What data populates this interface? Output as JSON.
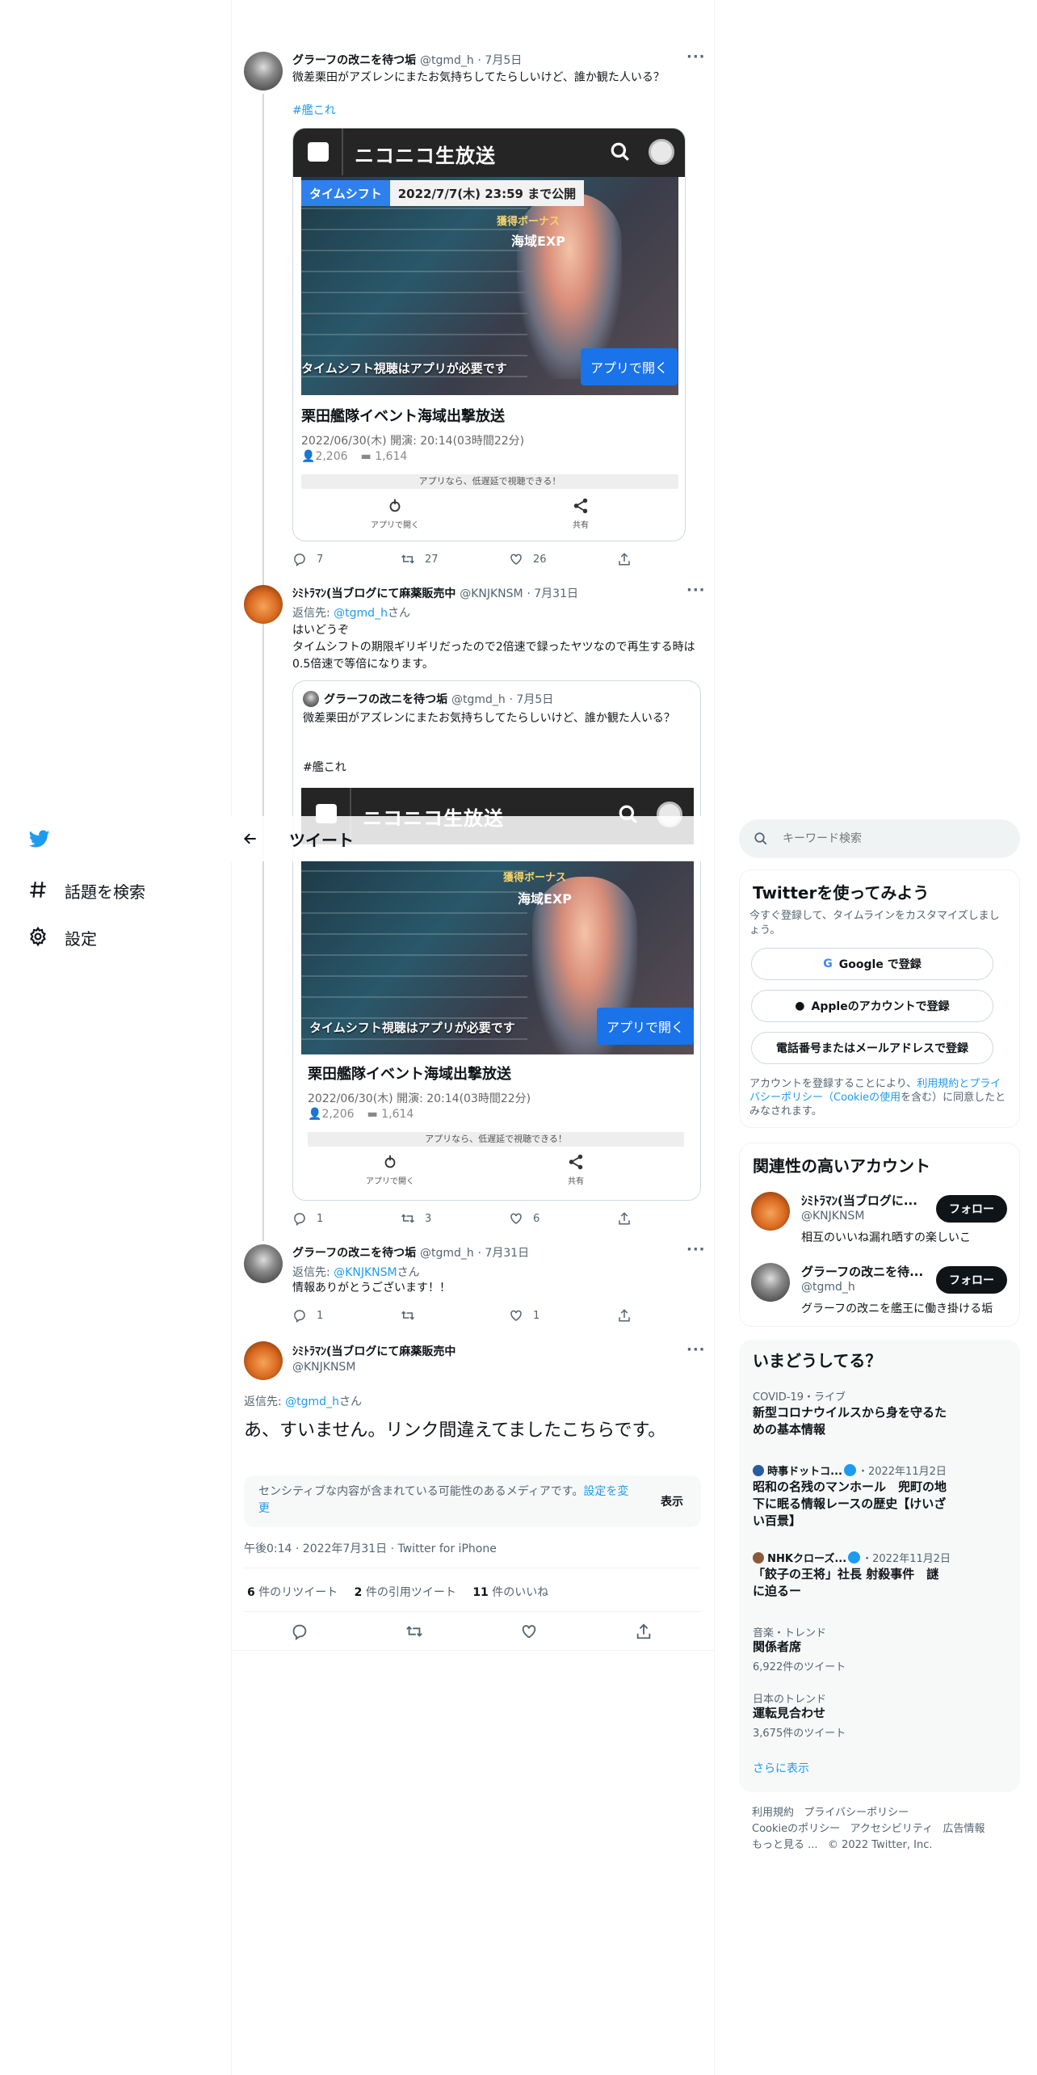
{
  "nav": {
    "explore_label": "話題を検索",
    "settings_label": "設定"
  },
  "header": {
    "title": "ツイート"
  },
  "search": {
    "placeholder": "キーワード検索"
  },
  "tweet1": {
    "name": "グラーフの改ニを待つ垢",
    "handle": "@tgmd_h",
    "date": "· 7月5日",
    "text": "微差栗田がアズレンにまたお気持ちしてたらしいけど、誰か観た人いる？",
    "hashtag": "#艦これ",
    "stats": {
      "replies": "7",
      "retweets": "27",
      "likes": "26"
    }
  },
  "card": {
    "brand": "ニコニコ生放送",
    "badge_label": "タイムシフト",
    "badge_date": "2022/7/7(木) 23:59 まで公開",
    "app_note": "タイムシフト視聴はアプリが必要です",
    "open_label": "アプリで開く",
    "title": "栗田艦隊イベント海域出撃放送",
    "meta": "2022/06/30(木) 開演: 20:14(03時間22分)",
    "viewers": "2,206",
    "comments": "1,614",
    "low_delay": "アプリなら、低遅延で視聴できる！",
    "act_open": "アプリで開く",
    "act_share": "共有",
    "bonus": "獲得ボーナス",
    "bonus2": "海域EXP"
  },
  "tweet2": {
    "name": "ｼﾐﾄﾗﾏﾝ(当ブログにて麻薬販売中",
    "handle": "@KNJKNSM",
    "date": "· 7月31日",
    "reply_prefix": "返信先: ",
    "reply_to": "@tgmd_h",
    "reply_suffix": "さん",
    "line1": "はいどうぞ",
    "line2": "タイムシフトの期限ギリギリだったので2倍速で録ったヤツなので再生する時は0.5倍速で等倍になります。",
    "stats": {
      "replies": "1",
      "retweets": "3",
      "likes": "6"
    }
  },
  "quote": {
    "name": "グラーフの改ニを待つ垢",
    "handle": "@tgmd_h",
    "date": "· 7月5日",
    "text": "微差栗田がアズレンにまたお気持ちしてたらしいけど、誰か観た人いる？",
    "hashtag": "#艦これ"
  },
  "tweet3": {
    "name": "グラーフの改ニを待つ垢",
    "handle": "@tgmd_h",
    "date": "· 7月31日",
    "reply_prefix": "返信先: ",
    "reply_to": "@KNJKNSM",
    "reply_suffix": "さん",
    "text": "情報ありがとうございます！！",
    "stats": {
      "replies": "1",
      "retweets": "",
      "likes": "1"
    }
  },
  "main": {
    "name": "ｼﾐﾄﾗﾏﾝ(当ブログにて麻薬販売中",
    "handle": "@KNJKNSM",
    "reply_prefix": "返信先: ",
    "reply_to": "@tgmd_h",
    "reply_suffix": "さん",
    "text": "あ、すいません。リンク間違えてましたこちらです。",
    "sensitive_text": "センシティブな内容が含まれている可能性のあるメディアです。",
    "sensitive_link": "設定を変更",
    "show_label": "表示",
    "timestamp": "午後0:14 · 2022年7月31日 · Twitter for iPhone",
    "retweets_count": "6",
    "retweets_label": " 件のリツイート",
    "quotes_count": "2",
    "quotes_label": " 件の引用ツイート",
    "likes_count": "11",
    "likes_label": " 件のいいね"
  },
  "signup": {
    "title": "Twitterを使ってみよう",
    "subtitle": "今すぐ登録して、タイムラインをカスタマイズしましょう。",
    "google": "Google で登録",
    "apple": "Appleのアカウントで登録",
    "phone": "電話番号またはメールアドレスで登録",
    "terms_prefix": "アカウントを登録することにより、",
    "terms_link": "利用規約とプライバシーポリシー（Cookieの使用",
    "terms_suffix": "を含む）に同意したとみなされます。"
  },
  "relevant": {
    "title": "関連性の高いアカウント",
    "follow_label": "フォロー",
    "accounts": [
      {
        "name": "ｼﾐﾄﾗﾏﾝ(当ブログに...",
        "handle": "@KNJKNSM",
        "bio": "相互のいいね漏れ晒すの楽しいこ"
      },
      {
        "name": "グラーフの改ニを待...",
        "handle": "@tgmd_h",
        "bio": "グラーフの改ニを艦王に働き掛ける垢"
      }
    ]
  },
  "trends": {
    "title": "いまどうしてる？",
    "items": [
      {
        "meta": "COVID-19・ライブ",
        "title": "新型コロナウイルスから身を守るための基本情報",
        "count": ""
      },
      {
        "meta": "時事ドットコ...",
        "meta2": "・2022年11月2日",
        "title": "昭和の名残のマンホール　兜町の地下に眠る情報レースの歴史【けいざい百景】",
        "count": ""
      },
      {
        "meta": "NHKクローズ...",
        "meta2": "・2022年11月2日",
        "title": "「餃子の王将」社長 射殺事件　謎に迫るー",
        "count": ""
      },
      {
        "meta": "音楽・トレンド",
        "title": "関係者席",
        "count": "6,922件のツイート"
      },
      {
        "meta": "日本のトレンド",
        "title": "運転見合わせ",
        "count": "3,675件のツイート"
      }
    ],
    "more": "さらに表示"
  },
  "footer": {
    "terms": "利用規約",
    "privacy": "プライバシーポリシー",
    "cookies": "Cookieのポリシー",
    "accessibility": "アクセシビリティ",
    "ads": "広告情報",
    "more": "もっと見る ...",
    "copyright": "© 2022 Twitter, Inc."
  },
  "colors": {
    "accent": "#1d9bf0",
    "text": "#0f1419",
    "muted": "#536471",
    "nico_blue": "#1a73e8"
  }
}
